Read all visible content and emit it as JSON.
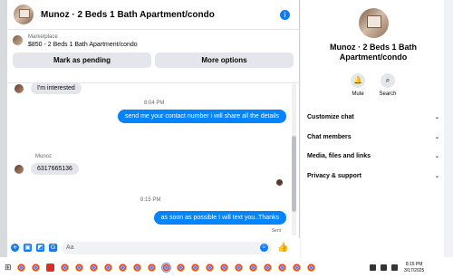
{
  "chat": {
    "title": "Munoz · 2 Beds 1 Bath Apartment/condo",
    "listing": {
      "source": "Marketplace",
      "price_line": "$850 - 2 Beds 1 Bath Apartment/condo",
      "pending_label": "Mark as pending",
      "more_label": "More options"
    },
    "messages": {
      "m1": "I'm interested",
      "t1": "8:04 PM",
      "m2": "send me your contact number i will share all the details",
      "sender": "Munoz",
      "m3": "6317665136",
      "t2": "8:15 PM",
      "m4": "as soon as possible I will text you..Thanks",
      "status": "Sent"
    },
    "composer": {
      "placeholder": "Aa"
    }
  },
  "sidebar": {
    "title": "Munoz · 2 Beds 1 Bath Apartment/condo",
    "mute_label": "Mute",
    "search_label": "Search",
    "rows": {
      "custom": "Customize chat",
      "members": "Chat members",
      "media": "Media, files and links",
      "privacy": "Privacy & support"
    }
  },
  "taskbar": {
    "time": "8:15 PM",
    "date": "3/17/2025"
  }
}
